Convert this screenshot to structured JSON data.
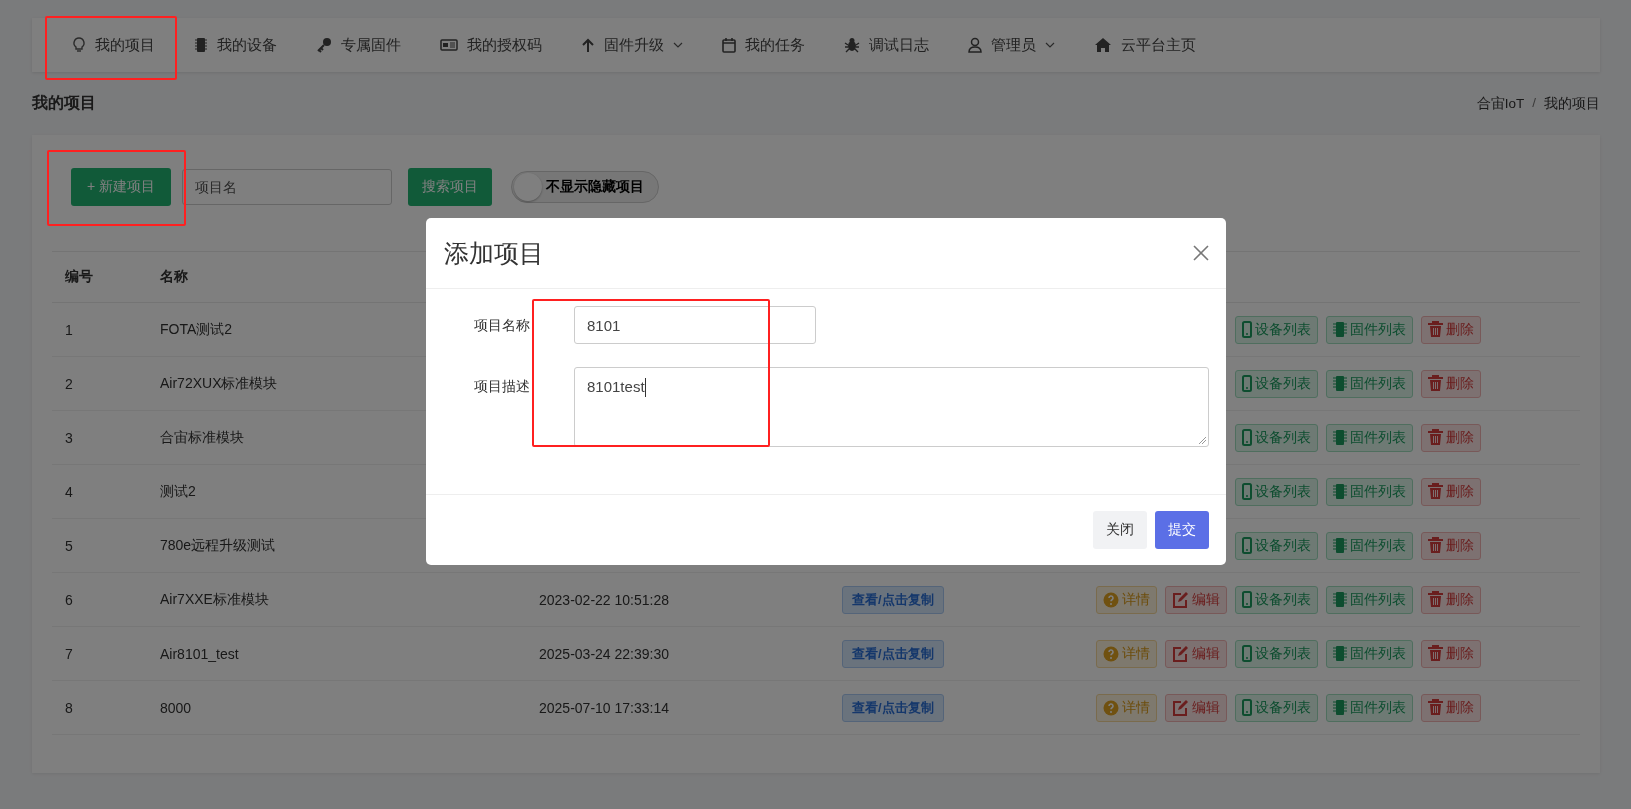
{
  "nav": [
    {
      "label": "我的项目",
      "kind": "bulb",
      "dropdown": false,
      "annotated": true
    },
    {
      "label": "我的设备",
      "kind": "chip",
      "dropdown": false,
      "annotated": false
    },
    {
      "label": "专属固件",
      "kind": "key",
      "dropdown": false,
      "annotated": false
    },
    {
      "label": "我的授权码",
      "kind": "card",
      "dropdown": false,
      "annotated": false
    },
    {
      "label": "固件升级",
      "kind": "arrow",
      "dropdown": true,
      "annotated": false
    },
    {
      "label": "我的任务",
      "kind": "calendar",
      "dropdown": false,
      "annotated": false
    },
    {
      "label": "调试日志",
      "kind": "bug",
      "dropdown": false,
      "annotated": false
    },
    {
      "label": "管理员",
      "kind": "user",
      "dropdown": true,
      "annotated": false
    },
    {
      "label": "云平台主页",
      "kind": "home",
      "dropdown": false,
      "annotated": false
    }
  ],
  "page_title": "我的项目",
  "breadcrumb": [
    "合宙IoT",
    "我的项目"
  ],
  "breadcrumb_separator": "/",
  "toolbar": {
    "new_button": {
      "label": "+ 新建项目",
      "annotated": true
    },
    "search": {
      "placeholder": "项目名"
    },
    "search_button": "搜索项目",
    "toggle": {
      "label": "不显示隐藏项目",
      "on": false
    }
  },
  "table": {
    "columns": [
      "编号",
      "名称"
    ],
    "rows": [
      {
        "id": "1",
        "name": "FOTA测试2",
        "actions": [
          {
            "kind": "devices",
            "label": "设备列表"
          },
          {
            "kind": "firmware",
            "label": "固件列表"
          },
          {
            "kind": "delete",
            "label": "删除"
          }
        ]
      },
      {
        "id": "2",
        "name": "Air72XUX标准模块",
        "actions": [
          {
            "kind": "devices",
            "label": "设备列表"
          },
          {
            "kind": "firmware",
            "label": "固件列表"
          },
          {
            "kind": "delete",
            "label": "删除"
          }
        ]
      },
      {
        "id": "3",
        "name": "合宙标准模块",
        "actions": [
          {
            "kind": "devices",
            "label": "设备列表"
          },
          {
            "kind": "firmware",
            "label": "固件列表"
          },
          {
            "kind": "delete",
            "label": "删除"
          }
        ]
      },
      {
        "id": "4",
        "name": "测试2",
        "actions": [
          {
            "kind": "devices",
            "label": "设备列表"
          },
          {
            "kind": "firmware",
            "label": "固件列表"
          },
          {
            "kind": "delete",
            "label": "删除"
          }
        ]
      },
      {
        "id": "5",
        "name": "780e远程升级测试",
        "actions": [
          {
            "kind": "devices",
            "label": "设备列表"
          },
          {
            "kind": "firmware",
            "label": "固件列表"
          },
          {
            "kind": "delete",
            "label": "删除"
          }
        ]
      },
      {
        "id": "6",
        "name": "Air7XXE标准模块",
        "created": "2023-02-22 10:51:28",
        "key_button": "查看/点击复制",
        "actions": [
          {
            "kind": "detail",
            "label": "详情"
          },
          {
            "kind": "edit",
            "label": "编辑"
          },
          {
            "kind": "devices",
            "label": "设备列表"
          },
          {
            "kind": "firmware",
            "label": "固件列表"
          },
          {
            "kind": "delete",
            "label": "删除"
          }
        ]
      },
      {
        "id": "7",
        "name": "Air8101_test",
        "created": "2025-03-24 22:39:30",
        "key_button": "查看/点击复制",
        "actions": [
          {
            "kind": "detail",
            "label": "详情"
          },
          {
            "kind": "edit",
            "label": "编辑"
          },
          {
            "kind": "devices",
            "label": "设备列表"
          },
          {
            "kind": "firmware",
            "label": "固件列表"
          },
          {
            "kind": "delete",
            "label": "删除"
          }
        ]
      },
      {
        "id": "8",
        "name": "8000",
        "created": "2025-07-10 17:33:14",
        "key_button": "查看/点击复制",
        "actions": [
          {
            "kind": "detail",
            "label": "详情"
          },
          {
            "kind": "edit",
            "label": "编辑"
          },
          {
            "kind": "devices",
            "label": "设备列表"
          },
          {
            "kind": "firmware",
            "label": "固件列表"
          },
          {
            "kind": "delete",
            "label": "删除"
          }
        ]
      }
    ]
  },
  "modal": {
    "title": "添加项目",
    "fields_annotated": true,
    "fields": [
      {
        "kind": "input",
        "label": "项目名称",
        "value": "8101"
      },
      {
        "kind": "textarea",
        "label": "项目描述",
        "value": "8101test"
      }
    ],
    "buttons": [
      {
        "kind": "secondary",
        "label": "关闭"
      },
      {
        "kind": "primary",
        "label": "提交"
      }
    ]
  }
}
